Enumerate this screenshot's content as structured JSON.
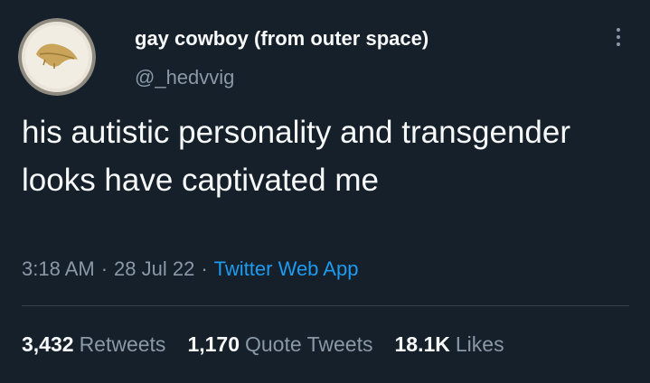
{
  "user": {
    "display_name": "gay cowboy (from outer space)",
    "handle": "@_hedvvig",
    "avatar_icon": "dried-leaf-on-plate-avatar"
  },
  "menu": {
    "icon": "more-vertical-icon"
  },
  "tweet": {
    "text": "his autistic personality and transgender looks have captivated me"
  },
  "meta": {
    "time": "3:18 AM",
    "separator": "·",
    "date": "28 Jul 22",
    "source": "Twitter Web App"
  },
  "stats": {
    "retweets_count": "3,432",
    "retweets_label": "Retweets",
    "quotes_count": "1,170",
    "quotes_label": "Quote Tweets",
    "likes_count": "18.1K",
    "likes_label": "Likes"
  },
  "colors": {
    "background": "#15202b",
    "text": "#f7f9f9",
    "secondary": "#8b98a5",
    "link": "#1d9bf0",
    "divider": "#38444d"
  }
}
